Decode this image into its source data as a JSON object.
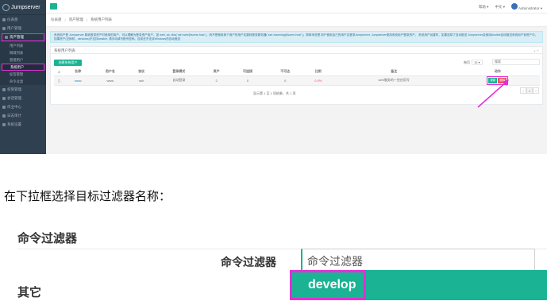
{
  "app": {
    "name": "Jumpserver"
  },
  "sidebar": {
    "items": [
      {
        "label": "仪表盘"
      },
      {
        "label": "用户管理"
      },
      {
        "label": "资产管理"
      },
      {
        "label": "用户列表"
      },
      {
        "label": "网域列表"
      },
      {
        "label": "管理用户"
      },
      {
        "label": "系统用户"
      },
      {
        "label": "标签管理"
      },
      {
        "label": "命令过滤"
      },
      {
        "label": "权限管理"
      },
      {
        "label": "会话管理"
      },
      {
        "label": "作业中心"
      },
      {
        "label": "日志审计"
      },
      {
        "label": "系统设置"
      }
    ]
  },
  "topbar": {
    "help": "帮助 ▾",
    "language": "中文 ▾",
    "user": "Administrator ▾"
  },
  "breadcrumb": [
    "仪表盘",
    "资产管理",
    "系统用户列表"
  ],
  "notice": "系统用户是 Jumpserver 跳转登录资产时使用的用户，可以理解为登录资产用户，如 web, sa, dba(`ssh web@some-host`)，而不是使用某个用户的用户名跳转登录服务器(`ssh xiaoming@some-host`)；简单来说是 用户使用自己的用户名登录Jumpserver, Jumpserver使用系统用户登录资产。 系统用户创建时，如果选择了自动推送 Jumpserver会使用Ansible自动推送系统用户到资产中，如果资产(交换机、windows)不支持ansible, 请手动填写账号密码。目前还不支持Windows的自动推送",
  "panel": {
    "title": "系统用户列表",
    "create_button": "创建系统用户",
    "page_size_label": "每页",
    "page_size_value": "15",
    "search_label": "搜索",
    "columns": [
      "#",
      "名称",
      "用户名",
      "协议",
      "登录模式",
      "资产",
      "可连接",
      "不可达",
      "比例",
      "备注",
      "动作"
    ],
    "rows": [
      [
        "",
        "www",
        "www",
        "ssh",
        "自动登录",
        "2",
        "0",
        "0",
        "0.0%",
        "web服务的一些应用号"
      ]
    ],
    "update_button": "更新",
    "delete_button": "删除",
    "pager_info": "显示第 1 至 1 项结果，共 1 项",
    "pages": [
      "‹",
      "1",
      "›"
    ]
  },
  "instruction": "在下拉框选择目标过滤器名称：",
  "form": {
    "section_title": "命令过滤器",
    "field_label": "命令过滤器",
    "field_placeholder": "命令过滤器",
    "selected_option": "develop",
    "other_section": "其它"
  },
  "colors": {
    "sidebar": "#2f4050",
    "accent": "#1ab394",
    "danger": "#ed5565",
    "highlight": "#e22fd8"
  }
}
